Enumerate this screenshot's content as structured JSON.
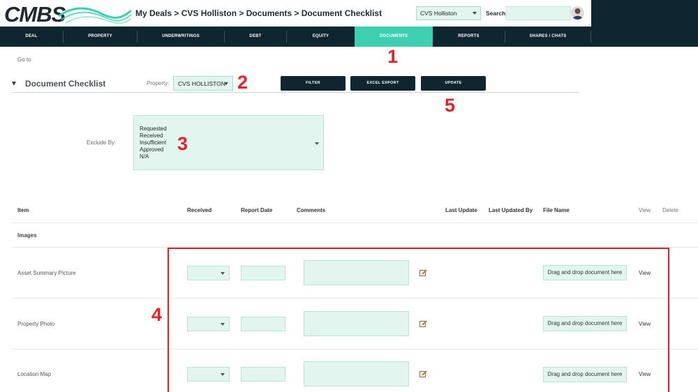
{
  "brand": {
    "logo_text": "CMBS"
  },
  "header": {
    "breadcrumb": "My Deals > CVS Holliston > Documents > Document Checklist",
    "deal_select": "CVS Holliston",
    "search_label": "Search",
    "search_value": ""
  },
  "nav": [
    "DEAL",
    "PROPERTY",
    "UNDERWRITINGS",
    "DEBT",
    "EQUITY",
    "DOCUMENTS",
    "REPORTS",
    "SHARES / CHATS"
  ],
  "nav_active": "DOCUMENTS",
  "toolbar": {
    "goto": "Go to",
    "title": "Document Checklist",
    "property_label": "Property:",
    "property_value": "CVS HOLLISTON",
    "filter": "FILTER",
    "excel_export": "EXCEL EXPORT",
    "update": "UPDATE"
  },
  "exclude": {
    "label": "Exclude By:",
    "options": [
      "Requested",
      "Received",
      "Insufficient",
      "Approved",
      "N/A"
    ]
  },
  "table": {
    "columns": [
      "Item",
      "Received",
      "Report Date",
      "Comments",
      "Last Update",
      "Last Updated By",
      "File Name",
      "View",
      "Delete"
    ],
    "group": "Images",
    "rows": [
      {
        "item": "Asset Summary Picture",
        "drop": "Drag and drop document here",
        "view": "View"
      },
      {
        "item": "Property Photo",
        "drop": "Drag and drop document here",
        "view": "View"
      },
      {
        "item": "Location Map",
        "drop": "Drag and drop document here",
        "view": "View"
      }
    ]
  },
  "callouts": [
    "1",
    "2",
    "3",
    "4",
    "5"
  ],
  "colors": {
    "navy": "#0f2530",
    "teal": "#3ecfb1",
    "mint": "#e2f6ef",
    "callout_red": "#e2232a"
  }
}
